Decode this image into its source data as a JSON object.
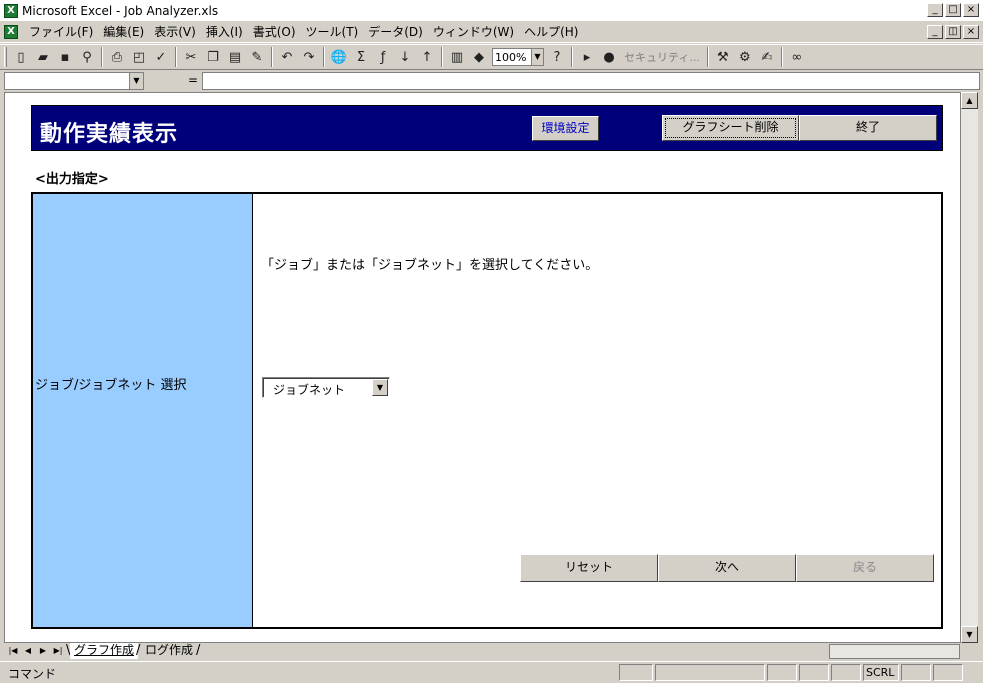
{
  "window": {
    "title": "Microsoft Excel - Job Analyzer.xls",
    "app_icon": "excel-icon"
  },
  "menubar": {
    "items": [
      "ファイル(F)",
      "編集(E)",
      "表示(V)",
      "挿入(I)",
      "書式(O)",
      "ツール(T)",
      "データ(D)",
      "ウィンドウ(W)",
      "ヘルプ(H)"
    ]
  },
  "toolbar": {
    "zoom": "100%",
    "security_label": "セキュリティ..."
  },
  "formula_bar": {
    "eq_symbol": "="
  },
  "sheet": {
    "header_title": "動作実績表示",
    "env_settings_label": "環境設定",
    "delete_graph_sheet_label": "グラフシート削除",
    "exit_label": "終了",
    "section_label": "<出力指定>",
    "left_label": "ジョブ/ジョブネット 選択",
    "instruction": "「ジョブ」または「ジョブネット」を選択してください。",
    "selector_value": "ジョブネット",
    "reset_label": "リセット",
    "next_label": "次へ",
    "back_label": "戻る"
  },
  "tabs": {
    "active": "グラフ作成",
    "inactive": "ログ作成"
  },
  "status": {
    "mode": "コマンド",
    "scrl": "SCRL"
  },
  "colors": {
    "header_band": "#00007b",
    "left_panel": "#99ccff",
    "env_button_text": "#0000c0"
  }
}
